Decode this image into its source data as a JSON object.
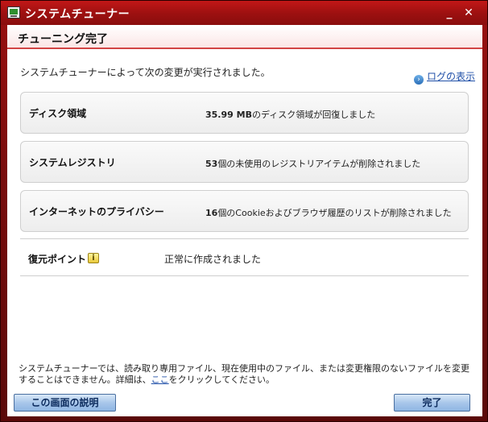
{
  "window": {
    "title": "システムチューナー",
    "minimize_glyph": "_",
    "close_glyph": "✕"
  },
  "header": {
    "title": "チューニング完了"
  },
  "intro_text": "システムチューナーによって次の変更が実行されました。",
  "log_link": {
    "icon": "arrow-circle-icon",
    "label": "ログの表示"
  },
  "results": [
    {
      "label": "ディスク領域",
      "value_strong": "35.99 MB",
      "value_rest": "のディスク領域が回復しました"
    },
    {
      "label": "システムレジストリ",
      "value_strong": "53",
      "value_rest": "個の未使用のレジストリアイテムが削除されました"
    },
    {
      "label": "インターネットのプライバシー",
      "value_strong": "16",
      "value_rest": "個のCookieおよびブラウザ履歴のリストが削除されました"
    }
  ],
  "restore_point": {
    "label": "復元ポイント",
    "icon": "info-icon",
    "value": "正常に作成されました"
  },
  "footer": {
    "note_before": "システムチューナーでは、読み取り専用ファイル、現在使用中のファイル、または変更権限のないファイルを変更することはできません。詳細は、",
    "link_text": "ここ",
    "note_after": "をクリックしてください。"
  },
  "buttons": {
    "help": "この画面の説明",
    "done": "完了"
  },
  "colors": {
    "title_bar": "#b01414",
    "accent_line": "#d24545",
    "link": "#1f4fa8",
    "button": "#a9c7ea"
  }
}
